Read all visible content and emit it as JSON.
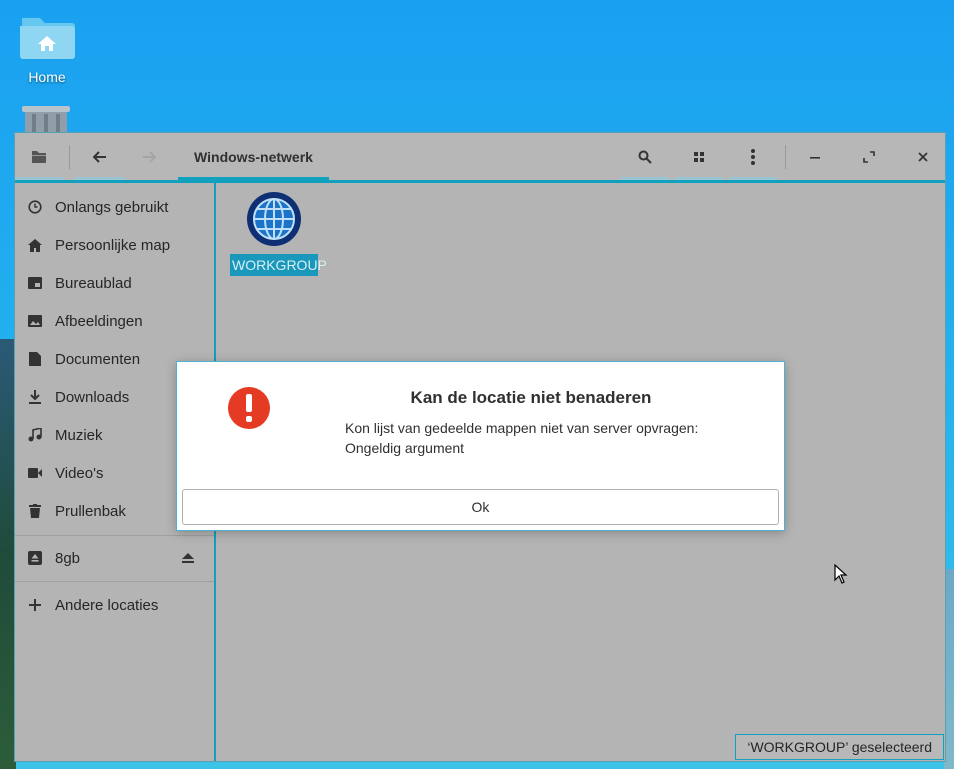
{
  "desktop": {
    "home_label": "Home"
  },
  "window": {
    "path_title": "Windows-netwerk",
    "accent_color": "#12a0bf"
  },
  "sidebar": {
    "items": [
      {
        "label": "Onlangs gebruikt",
        "icon": "clock-icon"
      },
      {
        "label": "Persoonlijke map",
        "icon": "home-icon"
      },
      {
        "label": "Bureaublad",
        "icon": "desktop-icon"
      },
      {
        "label": "Afbeeldingen",
        "icon": "image-icon"
      },
      {
        "label": "Documenten",
        "icon": "document-icon"
      },
      {
        "label": "Downloads",
        "icon": "download-icon"
      },
      {
        "label": "Muziek",
        "icon": "music-icon"
      },
      {
        "label": "Video's",
        "icon": "video-icon"
      },
      {
        "label": "Prullenbak",
        "icon": "trash-icon"
      }
    ],
    "drive": {
      "label": "8gb",
      "icon": "drive-icon"
    },
    "other": {
      "label": "Andere locaties",
      "icon": "plus-icon"
    }
  },
  "content": {
    "item_label": "WORKGROUP"
  },
  "status": {
    "text": "‘WORKGROUP’ geselecteerd"
  },
  "dialog": {
    "title": "Kan de locatie niet benaderen",
    "message_line1": "Kon lijst van gedeelde mappen niet van server opvragen:",
    "message_line2": "Ongeldig argument",
    "ok_label": "Ok",
    "error_color": "#e53a24"
  }
}
